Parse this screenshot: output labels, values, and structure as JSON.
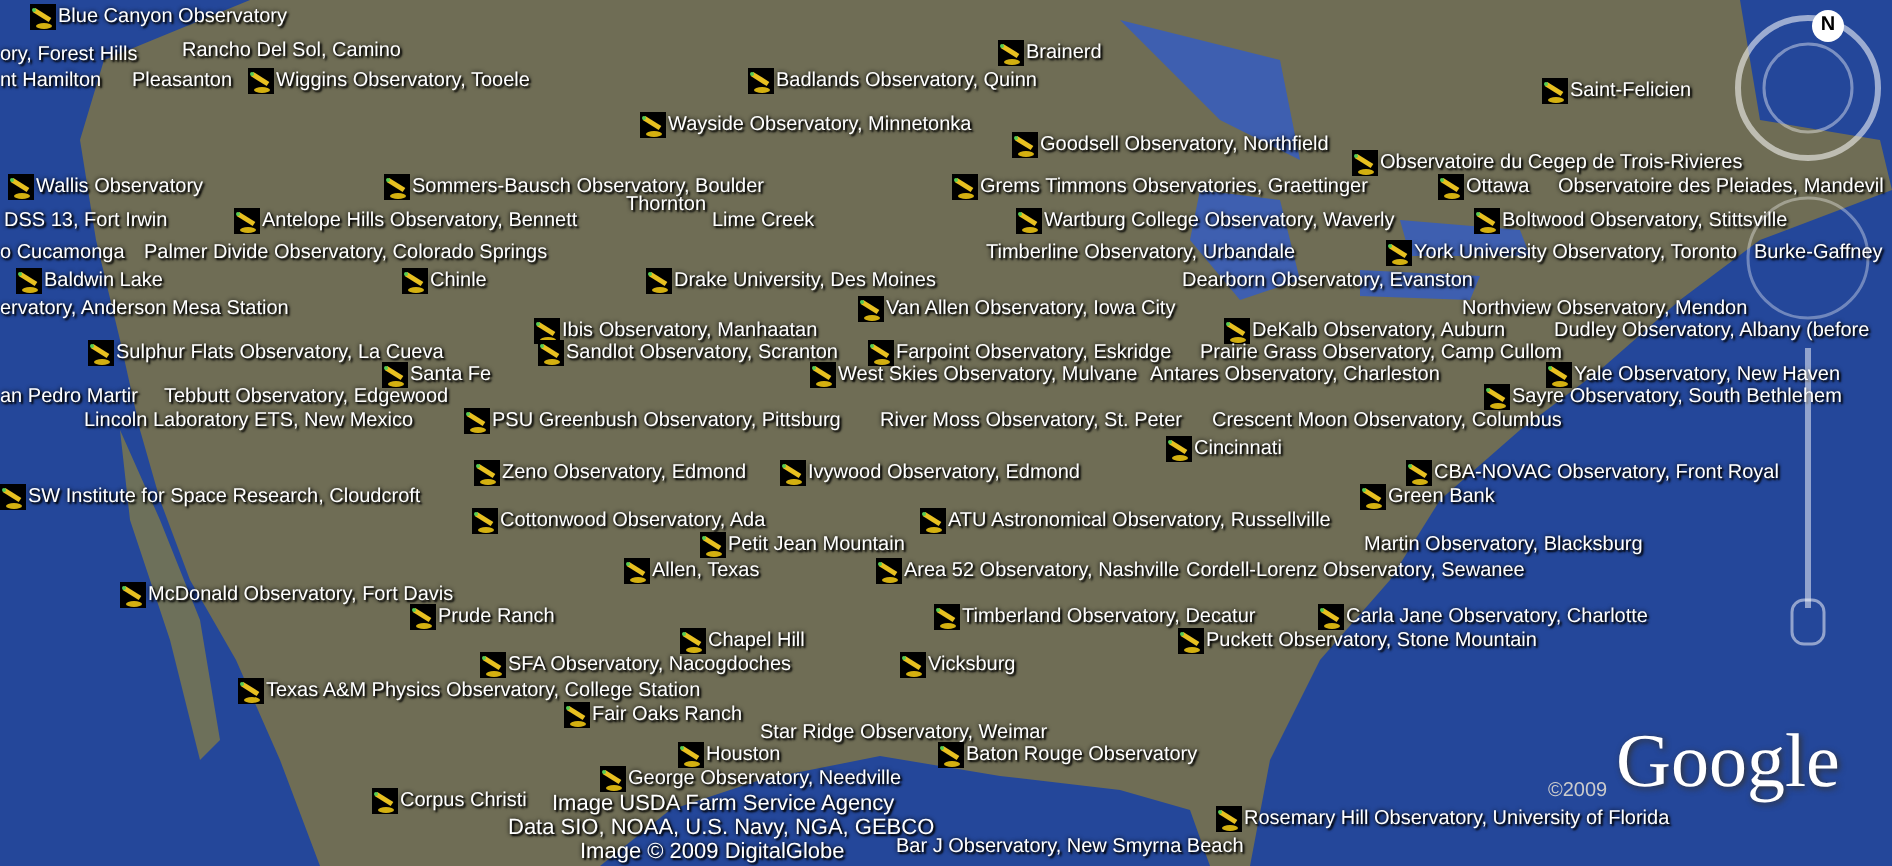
{
  "placemarks": [
    {
      "label": "Blue Canyon Observatory"
    },
    {
      "label": "ory, Forest Hills"
    },
    {
      "label": "Rancho Del Sol, Camino"
    },
    {
      "label": "Brainerd"
    },
    {
      "label": "nt Hamilton"
    },
    {
      "label": "Pleasanton"
    },
    {
      "label": "Wiggins Observatory, Tooele"
    },
    {
      "label": "Badlands Observatory, Quinn"
    },
    {
      "label": "Saint-Felicien"
    },
    {
      "label": "Wayside Observatory, Minnetonka"
    },
    {
      "label": "Goodsell Observatory, Northfield"
    },
    {
      "label": "Observatoire du Cegep de Trois-Rivieres"
    },
    {
      "label": "Wallis Observatory"
    },
    {
      "label": "Sommers-Bausch Observatory, Boulder"
    },
    {
      "label": "Grems Timmons Observatories, Graettinger"
    },
    {
      "label": "Ottawa"
    },
    {
      "label": "Observatoire des Pleiades, Mandevil"
    },
    {
      "label": "Thornton"
    },
    {
      "label": "DSS 13, Fort Irwin"
    },
    {
      "label": "Antelope Hills Observatory, Bennett"
    },
    {
      "label": "Lime Creek"
    },
    {
      "label": "Wartburg College Observatory, Waverly"
    },
    {
      "label": "Boltwood Observatory, Stittsville"
    },
    {
      "label": "o Cucamonga"
    },
    {
      "label": "Palmer Divide Observatory, Colorado Springs"
    },
    {
      "label": "Timberline Observatory, Urbandale"
    },
    {
      "label": "York University Observatory, Toronto"
    },
    {
      "label": "Burke-Gaffney"
    },
    {
      "label": "Baldwin Lake"
    },
    {
      "label": "Chinle"
    },
    {
      "label": "Drake University, Des Moines"
    },
    {
      "label": "Dearborn Observatory, Evanston"
    },
    {
      "label": "ervatory, Anderson Mesa Station"
    },
    {
      "label": "Van Allen Observatory, Iowa City"
    },
    {
      "label": "Northview Observatory, Mendon"
    },
    {
      "label": "Ibis Observatory, Manhaatan"
    },
    {
      "label": "DeKalb Observatory, Auburn"
    },
    {
      "label": "Dudley Observatory, Albany (before"
    },
    {
      "label": "Sulphur Flats Observatory, La Cueva"
    },
    {
      "label": "Sandlot Observatory, Scranton"
    },
    {
      "label": "Farpoint Observatory, Eskridge"
    },
    {
      "label": "Prairie Grass Observatory, Camp Cullom"
    },
    {
      "label": "Santa Fe"
    },
    {
      "label": "West Skies Observatory, Mulvane"
    },
    {
      "label": "Antares Observatory, Charleston"
    },
    {
      "label": "Yale Observatory, New Haven"
    },
    {
      "label": "an Pedro Martir"
    },
    {
      "label": "Tebbutt Observatory, Edgewood"
    },
    {
      "label": "Sayre Observatory, South Bethlehem"
    },
    {
      "label": "Lincoln Laboratory ETS, New Mexico"
    },
    {
      "label": "PSU Greenbush Observatory, Pittsburg"
    },
    {
      "label": "River Moss Observatory, St. Peter"
    },
    {
      "label": "Crescent Moon Observatory, Columbus"
    },
    {
      "label": "Cincinnati"
    },
    {
      "label": "Zeno Observatory, Edmond"
    },
    {
      "label": "Ivywood Observatory, Edmond"
    },
    {
      "label": "CBA-NOVAC Observatory, Front Royal"
    },
    {
      "label": "SW Institute for Space Research, Cloudcroft"
    },
    {
      "label": "Green Bank"
    },
    {
      "label": "Cottonwood Observatory, Ada"
    },
    {
      "label": "ATU Astronomical Observatory, Russellville"
    },
    {
      "label": "Petit Jean Mountain"
    },
    {
      "label": "Martin Observatory, Blacksburg"
    },
    {
      "label": "Allen, Texas"
    },
    {
      "label": "Area 52 Observatory, Nashville"
    },
    {
      "label": "Cordell-Lorenz Observatory, Sewanee"
    },
    {
      "label": "McDonald Observatory, Fort Davis"
    },
    {
      "label": "Prude Ranch"
    },
    {
      "label": "Timberland Observatory, Decatur"
    },
    {
      "label": "Carla Jane Observatory, Charlotte"
    },
    {
      "label": "Chapel Hill"
    },
    {
      "label": "Puckett Observatory, Stone Mountain"
    },
    {
      "label": "SFA Observatory, Nacogdoches"
    },
    {
      "label": "Vicksburg"
    },
    {
      "label": "Texas A&M Physics Observatory, College Station"
    },
    {
      "label": "Fair Oaks Ranch"
    },
    {
      "label": "Star Ridge Observatory, Weimar"
    },
    {
      "label": "Houston"
    },
    {
      "label": "Baton Rouge Observatory"
    },
    {
      "label": "George Observatory, Needville"
    },
    {
      "label": "Corpus Christi"
    },
    {
      "label": "Rosemary Hill Observatory, University of Florida"
    },
    {
      "label": "Bar J Observatory, New Smyrna Beach"
    }
  ],
  "attributions": [
    "Image USDA Farm Service Agency",
    "Data SIO, NOAA, U.S. Navy, NGA, GEBCO",
    "Image © 2009 DigitalGlobe"
  ],
  "copyright": "©2009",
  "logo": "Google",
  "compass": {
    "north_label": "N"
  }
}
